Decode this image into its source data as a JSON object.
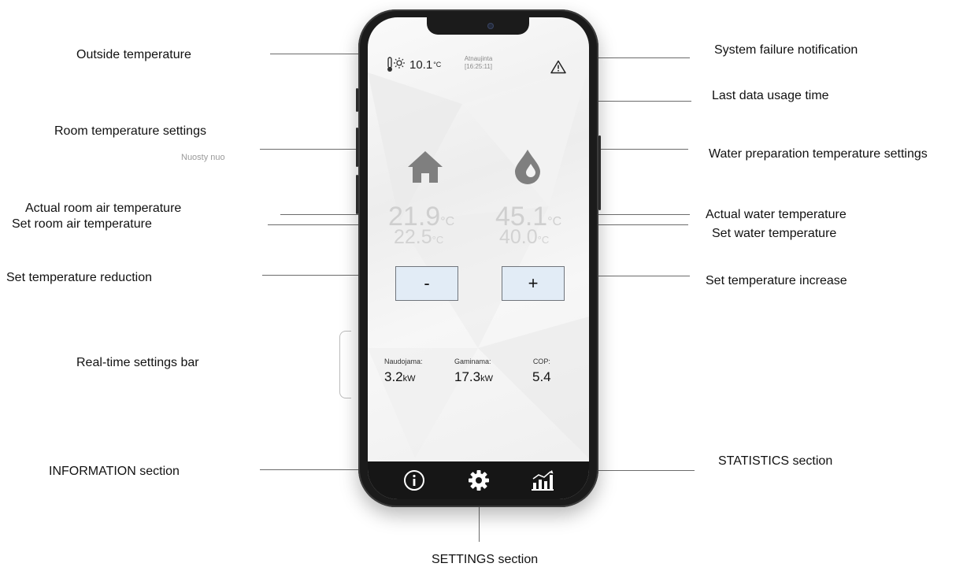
{
  "callouts": {
    "outside_temperature": "Outside temperature",
    "room_temperature_settings": "Room temperature settings",
    "actual_room_air_temperature": "Actual room air temperature",
    "set_room_air_temperature": "Set room air temperature",
    "set_temperature_reduction": "Set temperature reduction",
    "real_time_settings_bar": "Real-time settings bar",
    "information_section": "INFORMATION section",
    "system_failure_notification": "System failure notification",
    "last_data_usage_time": "Last data usage time",
    "water_preparation_temperature_settings": "Water preparation temperature settings",
    "actual_water_temperature": "Actual water temperature",
    "set_water_temperature": "Set water temperature",
    "set_temperature_increase": "Set temperature increase",
    "statistics_section": "STATISTICS section",
    "settings_section": "SETTINGS section"
  },
  "ghost_text": "Nuosty nuo",
  "app": {
    "outside_temp": "10.1",
    "temp_unit": "°C",
    "update_label": "Atnaujinta",
    "update_time": "[16:25:11]",
    "room": {
      "actual": "21.9",
      "set": "22.5",
      "icon": "house-icon"
    },
    "water": {
      "actual": "45.1",
      "set": "40.0",
      "icon": "water-drop-icon"
    },
    "buttons": {
      "decrease": "-",
      "increase": "+"
    },
    "stats": [
      {
        "label": "Naudojama:",
        "value": "3.2",
        "unit": "kW"
      },
      {
        "label": "Gaminama:",
        "value": "17.3",
        "unit": "kW"
      },
      {
        "label": "COP:",
        "value": "5.4",
        "unit": ""
      }
    ],
    "nav": [
      "info-icon",
      "gear-icon",
      "statistics-icon"
    ]
  },
  "colors": {
    "button_bg": "#e2ecf6",
    "navbar": "#161616",
    "faded_value": "#cfcfcf"
  }
}
